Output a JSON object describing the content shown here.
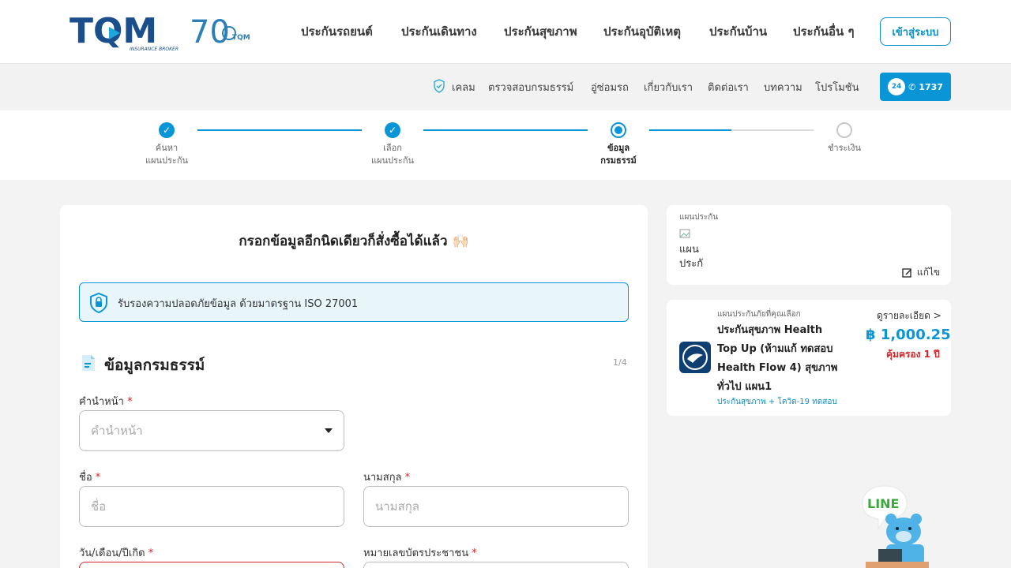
{
  "header": {
    "logo_text": "TQM",
    "logo_tagline": "INSURANCE BROKER",
    "anniversary_text": "70",
    "anniversary_brand": "TQM",
    "nav": [
      "ประกันรถยนต์",
      "ประกันเดินทาง",
      "ประกันสุขภาพ",
      "ประกันอุบัติเหตุ",
      "ประกันบ้าน",
      "ประกันอื่น ๆ"
    ],
    "login_label": "เข้าสู่ระบบ"
  },
  "subnav": {
    "items": [
      "เคลม",
      "ตรวจสอบกรมธรรม์",
      "อู่ซ่อมรถ",
      "เกี่ยวกับเรา",
      "ติดต่อเรา",
      "บทความ",
      "โปรโมชัน"
    ],
    "hotline_24": "24",
    "hotline_number": "1737"
  },
  "stepper": {
    "steps": [
      {
        "line1": "ค้นหา",
        "line2": "แผนประกัน",
        "state": "done"
      },
      {
        "line1": "เลือก",
        "line2": "แผนประกัน",
        "state": "done"
      },
      {
        "line1": "ข้อมูล",
        "line2": "กรมธรรม์",
        "state": "active"
      },
      {
        "line1": "ชำระเงิน",
        "line2": "",
        "state": "todo"
      }
    ]
  },
  "form": {
    "title": "กรอกข้อมูลอีกนิดเดียวก็สั่งซื้อได้แล้ว 🙌🏻",
    "iso_text": "รับรองความปลอดภัยข้อมูล ด้วยมาตรฐาน ISO 27001",
    "section_title": "ข้อมูลกรมธรรม์",
    "section_page": "1/4",
    "fields": {
      "prefix_label": "คำนำหน้า",
      "prefix_placeholder": "คำนำหน้า",
      "firstname_label": "ชื่อ",
      "firstname_placeholder": "ชื่อ",
      "lastname_label": "นามสกุล",
      "lastname_placeholder": "นามสกุล",
      "dob_label": "วัน/เดือน/ปีเกิด",
      "idcard_label": "หมายเลขบัตรประชาชน",
      "required_mark": "*"
    }
  },
  "plan_card": {
    "label": "แผนประกัน",
    "img_alt": "แผนประกั",
    "edit_label": "แก้ไข"
  },
  "selected_plan": {
    "label": "แผนประกันภัยที่คุณเลือก",
    "name": "ประกันสุขภาพ Health Top Up (ห้ามแก้ ทดสอบ Health Flow 4) สุขภาพทั่วไป แผน1",
    "sub": "ประกันสุขภาพ + โควิด-19 ทดสอบ",
    "detail_label": "ดูรายละเอียด >",
    "price": "฿ 1,000.25",
    "coverage": "คุ้มครอง 1 ปี"
  },
  "line_chat": {
    "label": "LINE"
  },
  "colors": {
    "brand": "#0a96d6",
    "navy": "#1b4f8c",
    "required": "#d6262b"
  }
}
